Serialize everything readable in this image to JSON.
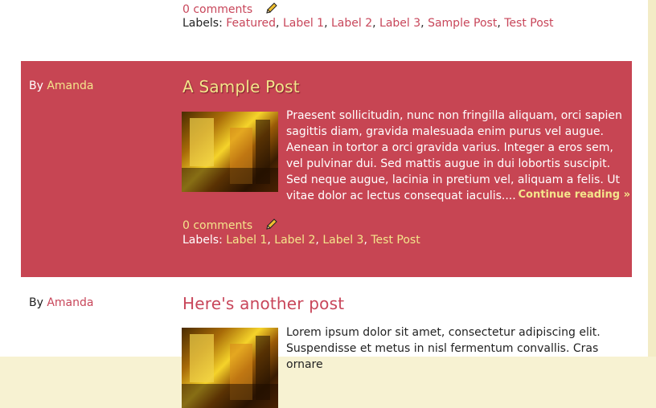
{
  "top_post": {
    "comments": "0 comments",
    "labels_prefix": "Labels:",
    "labels": [
      "Featured",
      "Label 1",
      "Label 2",
      "Label 3",
      "Sample Post",
      "Test Post"
    ]
  },
  "featured_post": {
    "by": "By",
    "author": "Amanda",
    "title": "A Sample Post",
    "excerpt": "Praesent sollicitudin, nunc non fringilla aliquam, orci sapien sagittis diam, gravida malesuada enim purus vel augue. Aenean in tortor a orci gravida varius. Integer a eros sem, vel pulvinar dui. Sed mattis augue in dui lobortis suscipit. Sed neque augue, lacinia in pretium vel, aliquam a felis. Ut vitae dolor ac lectus consequat iaculis....",
    "continue": "Continue reading »",
    "comments": "0 comments",
    "labels_prefix": "Labels:",
    "labels": [
      "Label 1",
      "Label 2",
      "Label 3",
      "Test Post"
    ]
  },
  "next_post": {
    "by": "By",
    "author": "Amanda",
    "title": "Here's another post",
    "excerpt": "Lorem ipsum dolor sit amet, consectetur adipiscing elit. Suspendisse et metus in nisl fermentum convallis. Cras ornare"
  },
  "colors": {
    "accent": "#c8465a",
    "featured_bg": "#c74553",
    "featured_link": "#f4e58b",
    "page_border": "#f7f2d2"
  }
}
